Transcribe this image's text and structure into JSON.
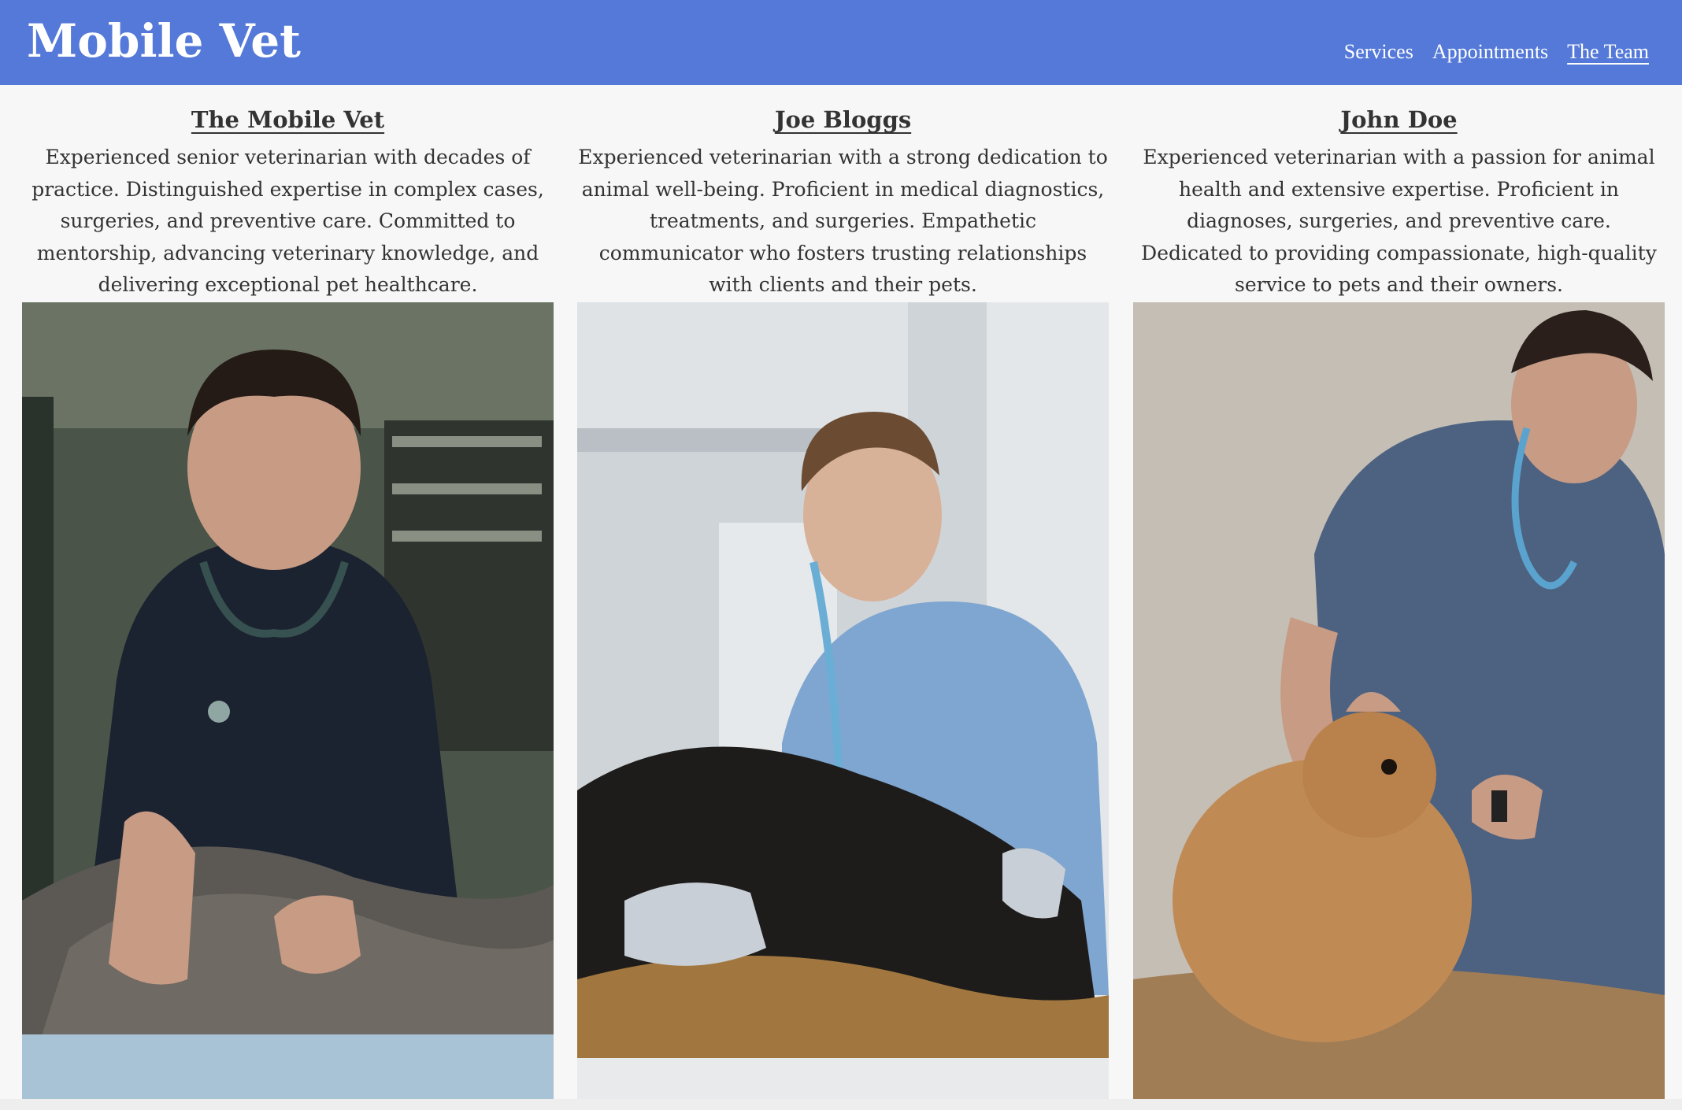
{
  "header": {
    "title": "Mobile Vet",
    "nav": [
      {
        "label": "Services"
      },
      {
        "label": "Appointments"
      },
      {
        "label": "The Team"
      }
    ],
    "active": "The Team",
    "background": "#5479d8"
  },
  "team": [
    {
      "name": "The Mobile Vet",
      "bio": "Experienced senior veterinarian with decades of practice. Distinguished expertise in complex cases, surgeries, and preventive care. Committed to mentorship, advancing veterinary knowledge, and delivering exceptional pet healthcare."
    },
    {
      "name": "Joe Bloggs",
      "bio": "Experienced veterinarian with a strong dedication to animal well-being. Proficient in medical diagnostics, treatments, and surgeries. Empathetic communicator who fosters trusting relationships with clients and their pets."
    },
    {
      "name": "John Doe",
      "bio": "Experienced veterinarian with a passion for animal health and extensive expertise. Proficient in diagnoses, surgeries, and preventive care. Dedicated to providing compassionate, high-quality service to pets and their owners."
    }
  ]
}
